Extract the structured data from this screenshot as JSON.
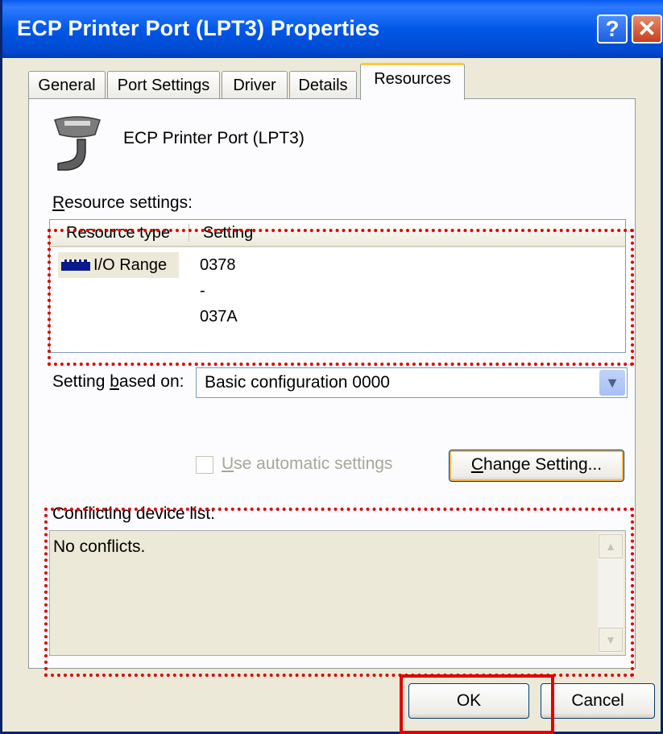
{
  "window": {
    "title": "ECP Printer Port (LPT3) Properties",
    "help_label": "?",
    "close_label": "✕"
  },
  "tabs": [
    {
      "label": "General"
    },
    {
      "label": "Port Settings"
    },
    {
      "label": "Driver"
    },
    {
      "label": "Details"
    },
    {
      "label": "Resources",
      "active": true
    }
  ],
  "device": {
    "name": "ECP Printer Port (LPT3)",
    "icon": "printer-port-icon"
  },
  "resources": {
    "label_prefix": "R",
    "label_rest": "esource settings:",
    "columns": [
      "Resource type",
      "Setting"
    ],
    "rows": [
      {
        "type": "I/O Range",
        "setting": "0378 - 037A",
        "icon": "memory-chip-icon"
      }
    ]
  },
  "setting_based_on": {
    "label_prefix": "Setting ",
    "label_u": "b",
    "label_rest": "ased on:",
    "value": "Basic configuration 0000"
  },
  "auto_settings": {
    "label_u": "U",
    "label_rest": "se automatic settings",
    "checked": false,
    "enabled": false
  },
  "change_setting": {
    "label_u": "C",
    "label_rest": "hange Setting..."
  },
  "conflicts": {
    "label": "Conflicting device list:",
    "text": "No conflicts."
  },
  "footer": {
    "ok_label": "OK",
    "cancel_label": "Cancel"
  },
  "colors": {
    "title_bar": "#0058E6",
    "dialog_bg": "#ECE9D8",
    "annotation_red": "#E00000",
    "active_tab_accent": "#FFC83C"
  }
}
